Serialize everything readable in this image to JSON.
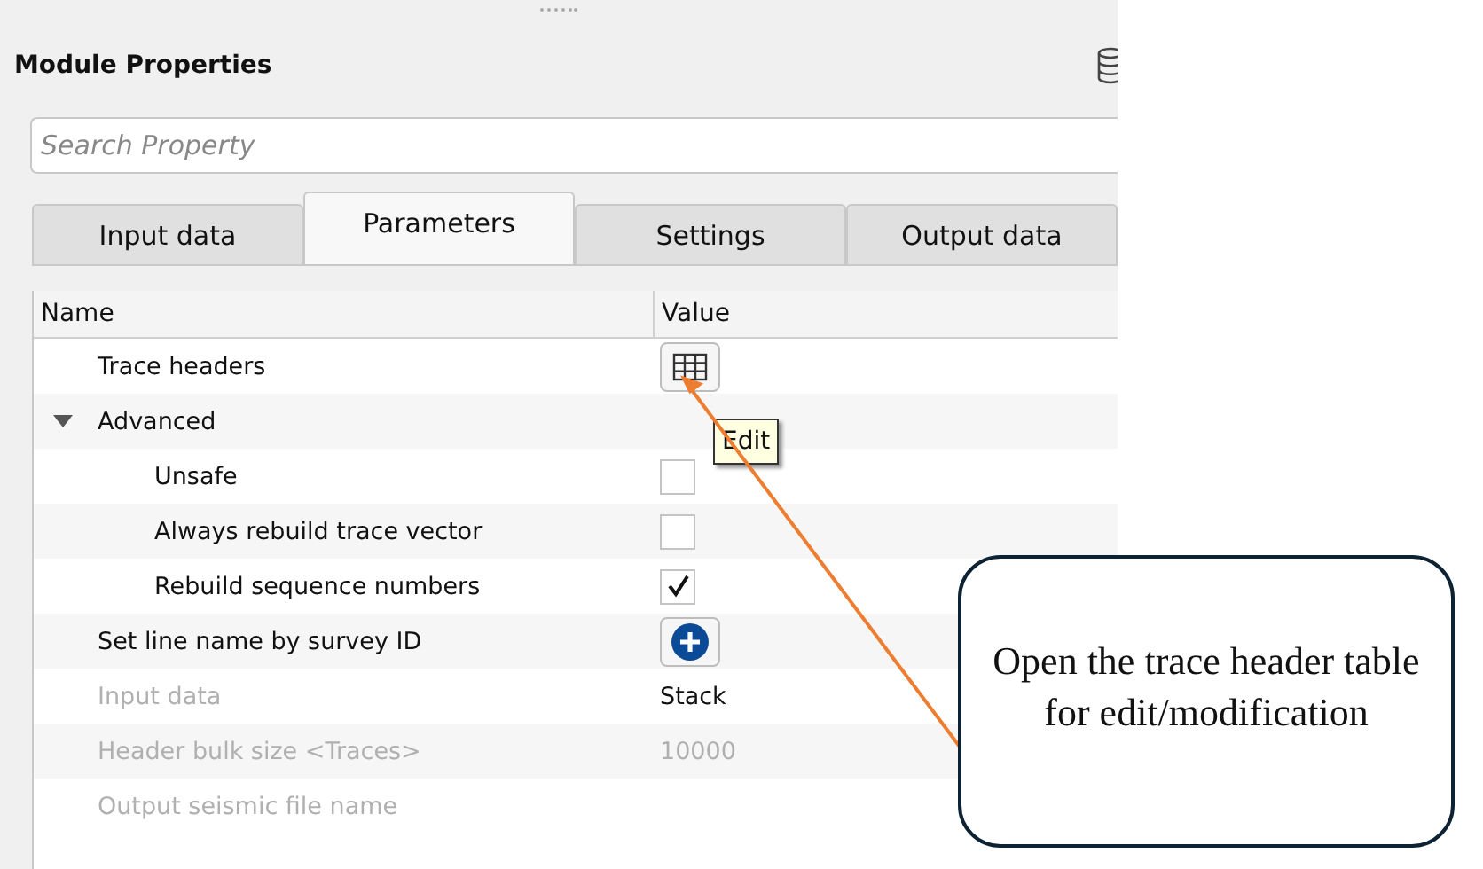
{
  "panel": {
    "title": "Module Properties"
  },
  "search": {
    "placeholder": "Search Property"
  },
  "tabs": [
    {
      "label": "Input data",
      "selected": false
    },
    {
      "label": "Parameters",
      "selected": true
    },
    {
      "label": "Settings",
      "selected": false
    },
    {
      "label": "Output data",
      "selected": false
    }
  ],
  "table": {
    "columns": [
      "Name",
      "Value"
    ],
    "rows": [
      {
        "name": "Trace headers",
        "kind": "table-button",
        "disabled": false
      },
      {
        "name": "Advanced",
        "kind": "group",
        "expanded": true,
        "disabled": false,
        "children": [
          {
            "name": "Unsafe",
            "kind": "checkbox",
            "checked": false,
            "disabled": false
          },
          {
            "name": "Always rebuild trace vector",
            "kind": "checkbox",
            "checked": false,
            "disabled": false
          },
          {
            "name": "Rebuild sequence numbers",
            "kind": "checkbox",
            "checked": true,
            "disabled": false
          }
        ]
      },
      {
        "name": "Set line name by survey ID",
        "kind": "add-button",
        "disabled": false
      },
      {
        "name": "Input data",
        "kind": "text",
        "value": "Stack",
        "value_disabled": false,
        "disabled": true
      },
      {
        "name": "Header bulk size <Traces>",
        "kind": "text",
        "value": "10000",
        "value_disabled": true,
        "disabled": true
      },
      {
        "name": "Output seismic file name",
        "kind": "text",
        "disabled": true
      }
    ]
  },
  "tooltip": {
    "text": "Edit"
  },
  "callout": {
    "text": "Open the trace header table for edit/modification"
  }
}
